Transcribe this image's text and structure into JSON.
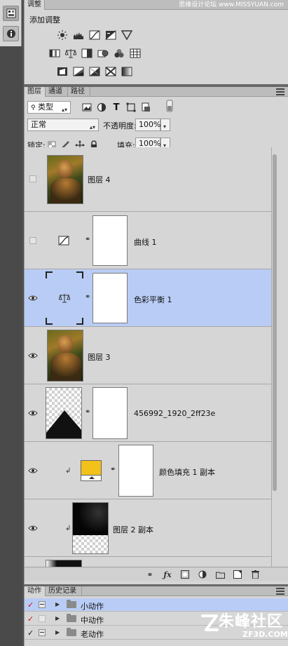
{
  "watermark": "思缘设计论坛 www.MISSYUAN.com",
  "adjustments": {
    "tab": "调整",
    "title": "添加调整",
    "rows": [
      [
        "brightness-contrast-icon",
        "levels-icon",
        "curves-icon",
        "exposure-icon",
        "vibrance-icon"
      ],
      [
        "hue-saturation-icon",
        "color-balance-icon",
        "black-white-icon",
        "photo-filter-icon",
        "channel-mixer-icon",
        "color-lookup-icon"
      ],
      [
        "invert-icon",
        "posterize-icon",
        "threshold-icon",
        "selective-color-icon",
        "gradient-map-icon"
      ]
    ]
  },
  "layers_panel": {
    "tabs": [
      "图层",
      "通道",
      "路径"
    ],
    "filter_kind": "类型",
    "blend_mode": "正常",
    "opacity_label": "不透明度:",
    "opacity": "100%",
    "lock_label": "锁定:",
    "fill_label": "填充:",
    "fill": "100%",
    "layers": [
      {
        "name": "图层 4",
        "visible": false,
        "type": "photo"
      },
      {
        "name": "曲线 1",
        "visible": false,
        "type": "curves"
      },
      {
        "name": "色彩平衡 1",
        "visible": true,
        "type": "color-balance",
        "selected": true
      },
      {
        "name": "图层 3",
        "visible": true,
        "type": "photo"
      },
      {
        "name": "456992_1920_2ff23e",
        "visible": true,
        "type": "masked"
      },
      {
        "name": "颜色填充 1 副本",
        "visible": true,
        "type": "fill",
        "clipped": true,
        "fill_color": "#f2c21a"
      },
      {
        "name": "图层 2 副本",
        "visible": true,
        "type": "dark",
        "clipped": true
      },
      {
        "name": "",
        "visible": true,
        "type": "partial"
      }
    ]
  },
  "actions_panel": {
    "tabs": [
      "动作",
      "历史记录"
    ],
    "items": [
      {
        "name": "小动作",
        "checked": true,
        "check_color": "#cc1111",
        "selected": true
      },
      {
        "name": "中动作",
        "checked": true,
        "check_color": "#cc1111",
        "selected": false
      },
      {
        "name": "老动作",
        "checked": true,
        "check_color": "#111111",
        "selected": false
      }
    ]
  },
  "brand": {
    "name": "朱峰社区",
    "sub": "ZF3D.COM"
  }
}
